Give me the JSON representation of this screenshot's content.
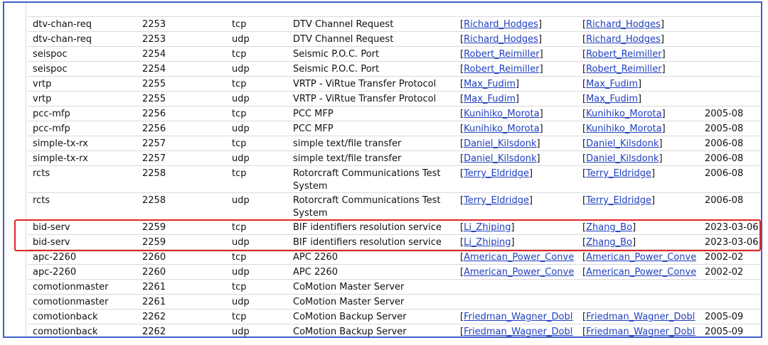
{
  "colors": {
    "frame_border": "#3d5fc8",
    "link": "#1f3fbf",
    "highlight": "#e02424",
    "row_divider": "#d9d9d9"
  },
  "partial_top_row": {
    "name": "",
    "port": "",
    "proto": "",
    "desc": ""
  },
  "rows": [
    {
      "name": "dtv-chan-req",
      "port": "2253",
      "proto": "tcp",
      "desc": "DTV Channel Request",
      "registrant": "Richard_Hodges",
      "contact": "Richard_Hodges",
      "date": ""
    },
    {
      "name": "dtv-chan-req",
      "port": "2253",
      "proto": "udp",
      "desc": "DTV Channel Request",
      "registrant": "Richard_Hodges",
      "contact": "Richard_Hodges",
      "date": ""
    },
    {
      "name": "seispoc",
      "port": "2254",
      "proto": "tcp",
      "desc": "Seismic P.O.C. Port",
      "registrant": "Robert_Reimiller",
      "contact": "Robert_Reimiller",
      "date": ""
    },
    {
      "name": "seispoc",
      "port": "2254",
      "proto": "udp",
      "desc": "Seismic P.O.C. Port",
      "registrant": "Robert_Reimiller",
      "contact": "Robert_Reimiller",
      "date": ""
    },
    {
      "name": "vrtp",
      "port": "2255",
      "proto": "tcp",
      "desc": "VRTP - ViRtue Transfer Protocol",
      "registrant": "Max_Fudim",
      "contact": "Max_Fudim",
      "date": ""
    },
    {
      "name": "vrtp",
      "port": "2255",
      "proto": "udp",
      "desc": "VRTP - ViRtue Transfer Protocol",
      "registrant": "Max_Fudim",
      "contact": "Max_Fudim",
      "date": ""
    },
    {
      "name": "pcc-mfp",
      "port": "2256",
      "proto": "tcp",
      "desc": "PCC MFP",
      "registrant": "Kunihiko_Morota",
      "contact": "Kunihiko_Morota",
      "date": "2005-08"
    },
    {
      "name": "pcc-mfp",
      "port": "2256",
      "proto": "udp",
      "desc": "PCC MFP",
      "registrant": "Kunihiko_Morota",
      "contact": "Kunihiko_Morota",
      "date": "2005-08"
    },
    {
      "name": "simple-tx-rx",
      "port": "2257",
      "proto": "tcp",
      "desc": "simple text/file transfer",
      "registrant": "Daniel_Kilsdonk",
      "contact": "Daniel_Kilsdonk",
      "date": "2006-08"
    },
    {
      "name": "simple-tx-rx",
      "port": "2257",
      "proto": "udp",
      "desc": "simple text/file transfer",
      "registrant": "Daniel_Kilsdonk",
      "contact": "Daniel_Kilsdonk",
      "date": "2006-08"
    },
    {
      "name": "rcts",
      "port": "2258",
      "proto": "tcp",
      "desc": "Rotorcraft Communications Test System",
      "registrant": "Terry_Eldridge",
      "contact": "Terry_Eldridge",
      "date": "2006-08",
      "tall": true
    },
    {
      "name": "rcts",
      "port": "2258",
      "proto": "udp",
      "desc": "Rotorcraft Communications Test System",
      "registrant": "Terry_Eldridge",
      "contact": "Terry_Eldridge",
      "date": "2006-08",
      "tall": true
    },
    {
      "name": "bid-serv",
      "port": "2259",
      "proto": "tcp",
      "desc": "BIF identifiers resolution service",
      "registrant": "Li_Zhiping",
      "contact": "Zhang_Bo",
      "date": "2023-03-06"
    },
    {
      "name": "bid-serv",
      "port": "2259",
      "proto": "udp",
      "desc": "BIF identifiers resolution service",
      "registrant": "Li_Zhiping",
      "contact": "Zhang_Bo",
      "date": "2023-03-06"
    },
    {
      "name": "apc-2260",
      "port": "2260",
      "proto": "tcp",
      "desc": "APC 2260",
      "registrant": "American_Power_Conve",
      "contact": "American_Power_Conve",
      "date": "2002-02"
    },
    {
      "name": "apc-2260",
      "port": "2260",
      "proto": "udp",
      "desc": "APC 2260",
      "registrant": "American_Power_Conve",
      "contact": "American_Power_Conve",
      "date": "2002-02"
    },
    {
      "name": "comotionmaster",
      "port": "2261",
      "proto": "tcp",
      "desc": "CoMotion Master Server",
      "registrant": "",
      "contact": "",
      "date": ""
    },
    {
      "name": "comotionmaster",
      "port": "2261",
      "proto": "udp",
      "desc": "CoMotion Master Server",
      "registrant": "",
      "contact": "",
      "date": ""
    },
    {
      "name": "comotionback",
      "port": "2262",
      "proto": "tcp",
      "desc": "CoMotion Backup Server",
      "registrant": "Friedman_Wagner_Dobl",
      "contact": "Friedman_Wagner_Dobl",
      "date": "2005-09"
    },
    {
      "name": "comotionback",
      "port": "2262",
      "proto": "udp",
      "desc": "CoMotion Backup Server",
      "registrant": "Friedman_Wagner_Dobl",
      "contact": "Friedman_Wagner_Dobl",
      "date": "2005-09"
    }
  ]
}
